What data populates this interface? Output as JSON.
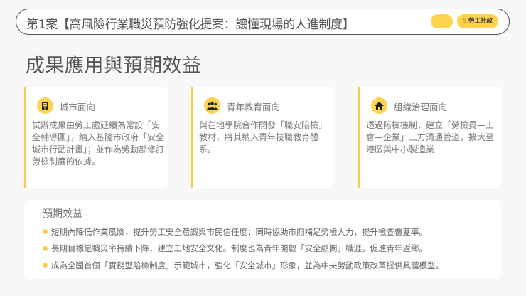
{
  "header": {
    "title": "第1案【高風險行業職災預防強化提案：讓懂現場的人進制度】",
    "tag_number": "5.",
    "tag_label": "勞工社政"
  },
  "heading": "成果應用與預期效益",
  "cards": [
    {
      "icon": "building-icon",
      "title": "城市面向",
      "body": "試辦成果由勞工處延續為常設「安全輔導團」，納入基隆市政府「安全城市行動計畫」；並作為勞動部修訂勞檢制度的依據。"
    },
    {
      "icon": "users-icon",
      "title": "青年教育面向",
      "body": "與在地學院合作開發「職安陪檢」教材，將其納入青年技職教育體系。"
    },
    {
      "icon": "home-icon",
      "title": "組織治理面向",
      "body": "透過陪檢機制，建立「勞檢員—工會—企業」三方溝通管道，擴大至港區與中小製造業"
    }
  ],
  "benefits": {
    "title": "預期效益",
    "items": [
      "短期內降低作業風險，提升勞工安全意識與市民信任度；同時協助市府補足勞檢人力，提升檢查覆蓋率。",
      "長期目標是職災率持續下降，建立工地安全文化。制度也為青年開啟「安全顧問」職涯，促進青年返鄉。",
      "成為全國首個「實務型陪檢制度」示範城市，強化「安全城市」形象，並為中央勞動政策改革提供具體模型。"
    ]
  },
  "colors": {
    "accent": "#fdd34f",
    "border": "#f5cd4a"
  }
}
